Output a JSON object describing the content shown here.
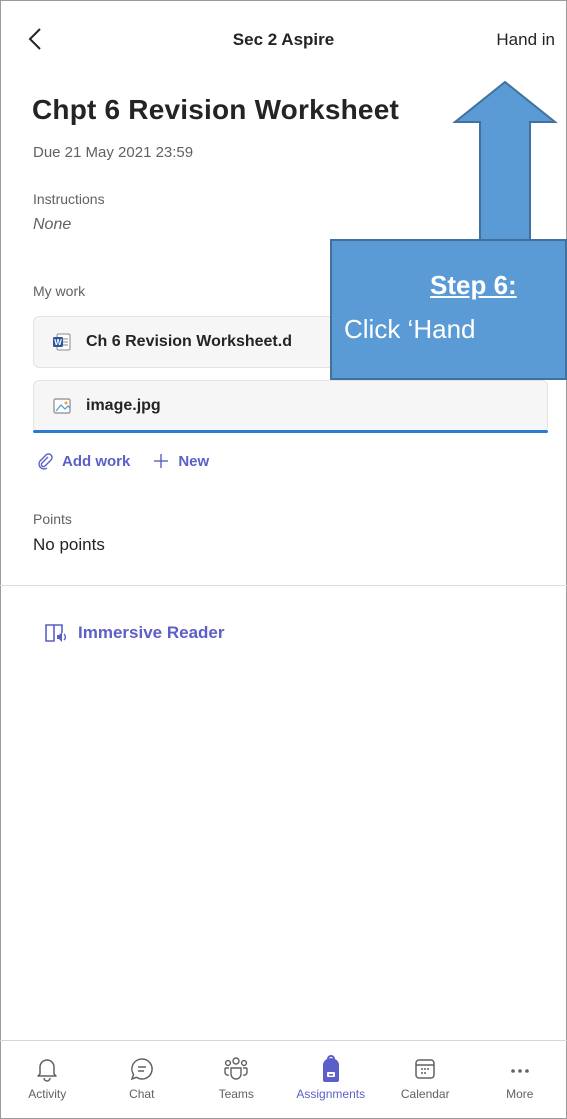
{
  "header": {
    "title": "Sec 2 Aspire",
    "action_label": "Hand in"
  },
  "assignment": {
    "title": "Chpt 6 Revision Worksheet",
    "due": "Due 21 May 2021 23:59",
    "instructions_label": "Instructions",
    "instructions_value": "None",
    "my_work_label": "My work",
    "files": [
      {
        "name": "Ch 6 Revision Worksheet.d",
        "icon": "word-doc-icon"
      },
      {
        "name": "image.jpg",
        "icon": "image-file-icon"
      }
    ],
    "add_work_label": "Add work",
    "new_label": "New",
    "points_label": "Points",
    "points_value": "No points",
    "immersive_reader_label": "Immersive Reader"
  },
  "callout": {
    "title": "Step 6:",
    "text": "Click ‘Hand"
  },
  "nav": {
    "items": [
      {
        "label": "Activity",
        "icon": "bell-icon"
      },
      {
        "label": "Chat",
        "icon": "chat-icon"
      },
      {
        "label": "Teams",
        "icon": "teams-icon"
      },
      {
        "label": "Assignments",
        "icon": "assignments-icon",
        "active": true
      },
      {
        "label": "Calendar",
        "icon": "calendar-icon"
      },
      {
        "label": "More",
        "icon": "more-icon"
      }
    ]
  },
  "colors": {
    "accent": "#5b5fc7",
    "callout_fill": "#5b9bd5",
    "callout_border": "#41719c",
    "progress_line": "#2b7bd3"
  }
}
